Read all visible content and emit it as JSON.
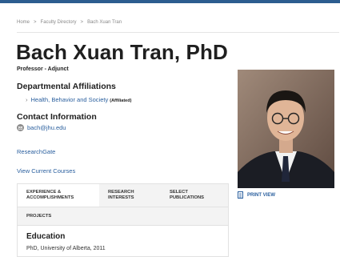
{
  "breadcrumb": {
    "items": [
      "Home",
      "Faculty Directory",
      "Bach Xuan Tran"
    ],
    "separator": ">"
  },
  "profile": {
    "name": "Bach Xuan Tran, PhD",
    "title": "Professor - Adjunct"
  },
  "departments": {
    "heading": "Departmental Affiliations",
    "items": [
      {
        "label": "Health, Behavior and Society",
        "tag": "(Affiliated)"
      }
    ]
  },
  "contact": {
    "heading": "Contact Information",
    "email": "bach@jhu.edu"
  },
  "links": {
    "researchgate": "ResearchGate",
    "courses": "View Current Courses"
  },
  "tabs": [
    {
      "label_line1": "EXPERIENCE &",
      "label_line2": "ACCOMPLISHMENTS",
      "active": true
    },
    {
      "label_line1": "RESEARCH",
      "label_line2": "INTERESTS",
      "active": false
    },
    {
      "label_line1": "SELECT",
      "label_line2": "PUBLICATIONS",
      "active": false
    },
    {
      "label_line1": "PROJECTS",
      "label_line2": "",
      "active": false
    }
  ],
  "education": {
    "heading": "Education",
    "degree": "PhD, University of Alberta, 2011"
  },
  "print": {
    "label": "PRINT VIEW"
  },
  "colors": {
    "link": "#2a5f9e",
    "topbar": "#2c5d8f"
  }
}
